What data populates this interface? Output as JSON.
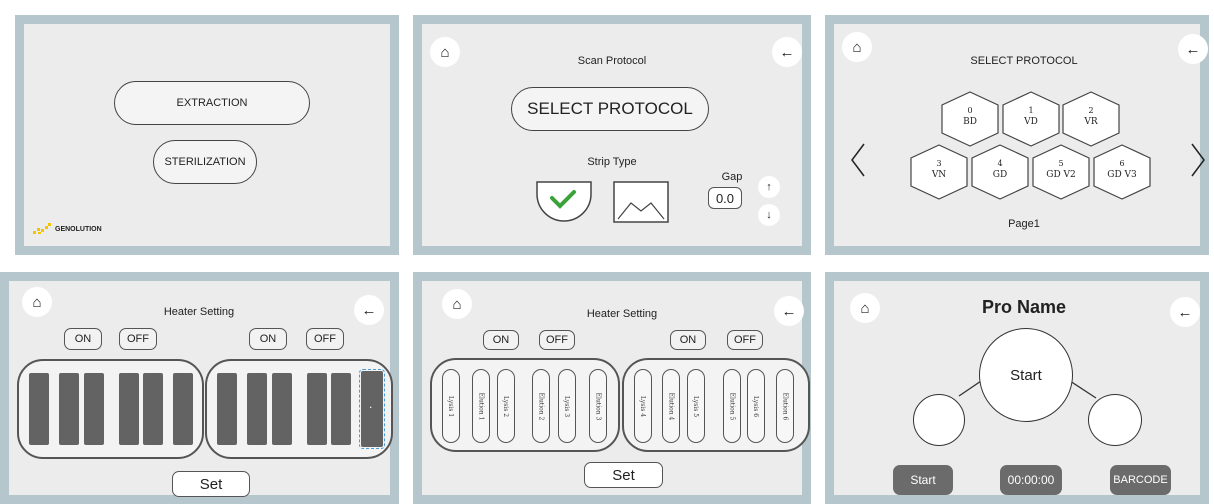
{
  "panel1": {
    "extraction_label": "EXTRACTION",
    "sterilization_label": "STERILIZATION",
    "logo_text": "GENOLUTION",
    "logo_color": "#f5c400"
  },
  "panel2": {
    "title": "Scan Protocol",
    "select_protocol_label": "SELECT PROTOCOL",
    "strip_type_label": "Strip Type",
    "gap_label": "Gap",
    "gap_value": "0.0",
    "check_color": "#3aa23a",
    "up_arrow": "↑",
    "down_arrow": "↓"
  },
  "panel3": {
    "title": "SELECT PROTOCOL",
    "page_label": "Page1",
    "protocols": [
      {
        "number": "0",
        "name": "BD"
      },
      {
        "number": "1",
        "name": "VD"
      },
      {
        "number": "2",
        "name": "VR"
      },
      {
        "number": "3",
        "name": "VN"
      },
      {
        "number": "4",
        "name": "GD"
      },
      {
        "number": "5",
        "name": "GD V2"
      },
      {
        "number": "6",
        "name": "GD V3"
      }
    ]
  },
  "panel4": {
    "title": "Heater Setting",
    "on_label": "ON",
    "off_label": "OFF",
    "set_label": "Set",
    "selected_dot": "."
  },
  "panel5": {
    "title": "Heater Setting",
    "on_label": "ON",
    "off_label": "OFF",
    "set_label": "Set",
    "left_slots": [
      "Lysis 1",
      "Elution 1",
      "Lysis 2",
      "Elution 2",
      "Lysis 3",
      "Elution 3"
    ],
    "right_slots": [
      "Lysis 4",
      "Elution 4",
      "Lysis 5",
      "Elution 5",
      "Lysis 6",
      "Elution 6"
    ]
  },
  "panel6": {
    "title": "Pro Name",
    "center_label": "Start",
    "start_button": "Start",
    "timer": "00:00:00",
    "barcode_button": "BARCODE"
  },
  "icons": {
    "home": "⌂",
    "back": "←",
    "prev": "〈",
    "next": "〉"
  },
  "colors": {
    "panel_border": "#b5c7cd",
    "panel_bg": "#ececec",
    "dark_slot": "#636363",
    "dark_button": "#6b6b6b"
  }
}
